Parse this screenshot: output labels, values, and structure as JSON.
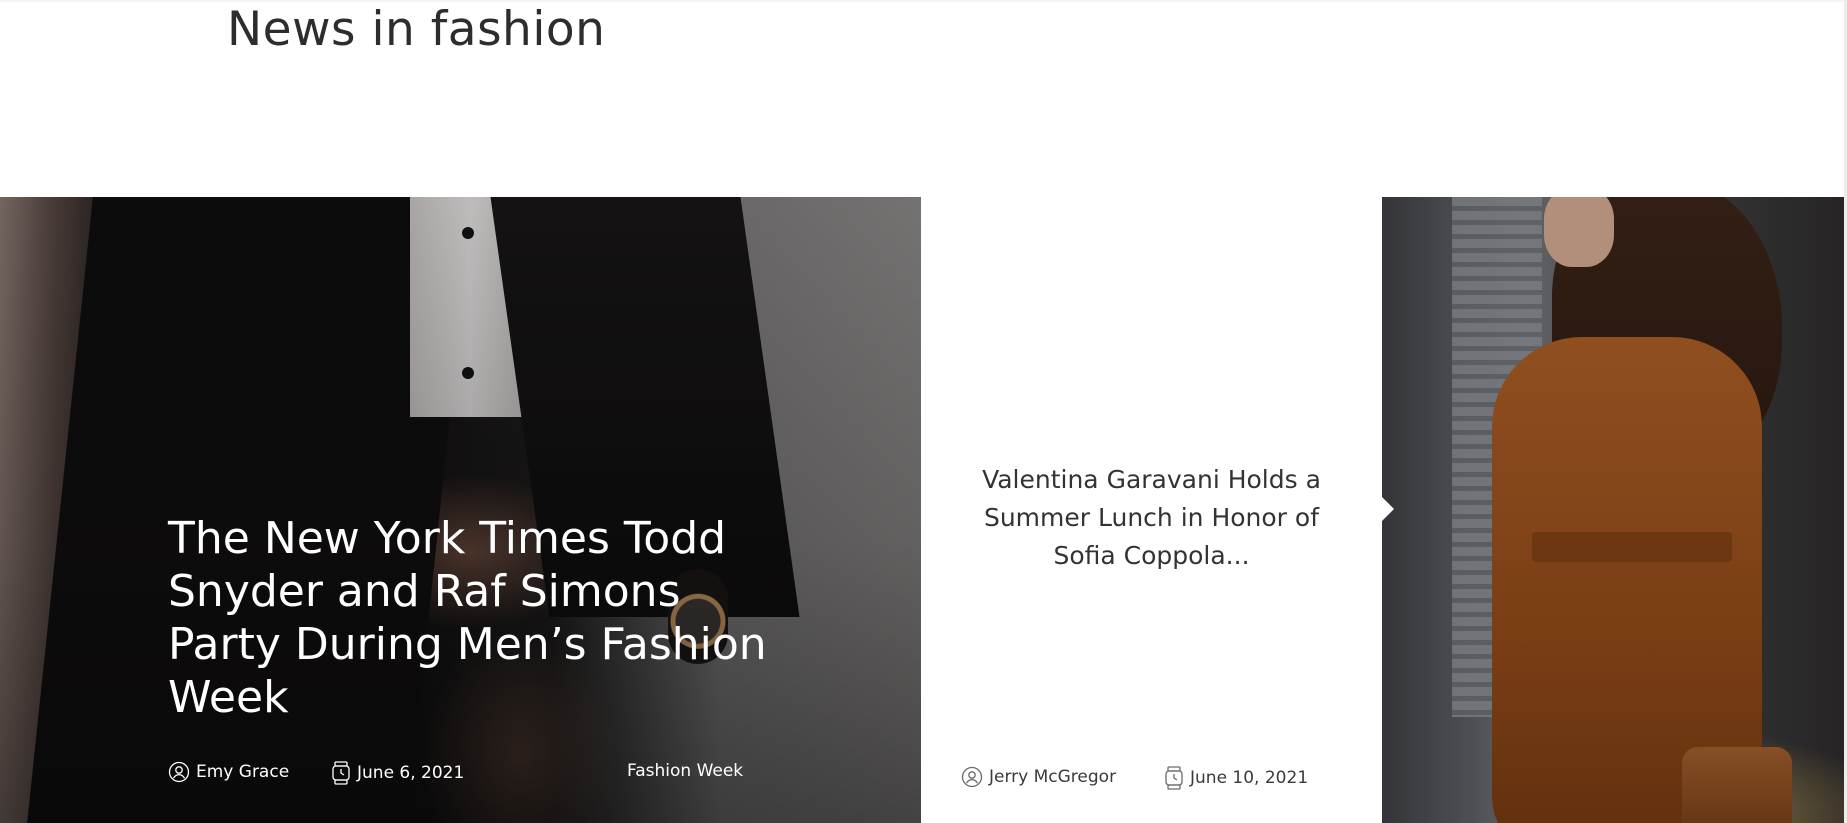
{
  "section": {
    "title": "News in fashion"
  },
  "posts": [
    {
      "title": "The New York Times Todd Snyder and Raf Simons Party During Men’s Fashion Week",
      "author": "Emy Grace",
      "date": "June 6, 2021",
      "tag": "Fashion Week",
      "author_icon": "user-icon",
      "date_icon": "watch-icon"
    },
    {
      "title": "Valentina Garavani Holds a Summer Lunch in Honor of Sofia Coppola...",
      "author": "Jerry McGregor",
      "date": "June 10, 2021",
      "author_icon": "user-icon",
      "date_icon": "watch-icon"
    }
  ],
  "colors": {
    "text_dark": "#333333",
    "text_light": "#ffffff",
    "background": "#ffffff"
  }
}
